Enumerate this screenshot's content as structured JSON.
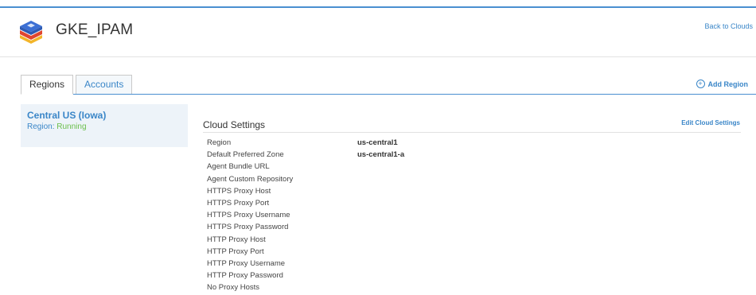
{
  "header": {
    "title": "GKE_IPAM",
    "back_link": "Back to Clouds",
    "logo_icon": "cloud-stack-logo-icon"
  },
  "tabs": [
    {
      "label": "Regions",
      "active": true
    },
    {
      "label": "Accounts",
      "active": false
    }
  ],
  "add_region": {
    "label": "Add Region",
    "icon": "plus-circle-icon"
  },
  "region_card": {
    "name": "Central US (Iowa)",
    "status_prefix": "Region:",
    "status": "Running"
  },
  "cloud_settings": {
    "title": "Cloud Settings",
    "edit_label": "Edit Cloud Settings",
    "rows": [
      {
        "label": "Region",
        "value": "us-central1"
      },
      {
        "label": "Default Preferred Zone",
        "value": "us-central1-a"
      },
      {
        "label": "Agent Bundle URL",
        "value": ""
      },
      {
        "label": "Agent Custom Repository",
        "value": ""
      },
      {
        "label": "HTTPS Proxy Host",
        "value": ""
      },
      {
        "label": "HTTPS Proxy Port",
        "value": ""
      },
      {
        "label": "HTTPS Proxy Username",
        "value": ""
      },
      {
        "label": "HTTPS Proxy Password",
        "value": ""
      },
      {
        "label": "HTTP Proxy Host",
        "value": ""
      },
      {
        "label": "HTTP Proxy Port",
        "value": ""
      },
      {
        "label": "HTTP Proxy Username",
        "value": ""
      },
      {
        "label": "HTTP Proxy Password",
        "value": ""
      },
      {
        "label": "No Proxy Hosts",
        "value": ""
      }
    ]
  },
  "colors": {
    "accent": "#3a86c8",
    "running": "#6abf4b",
    "logo_blue": "#3b6fd4",
    "logo_red": "#e0452f",
    "logo_yellow": "#f3b52a"
  }
}
